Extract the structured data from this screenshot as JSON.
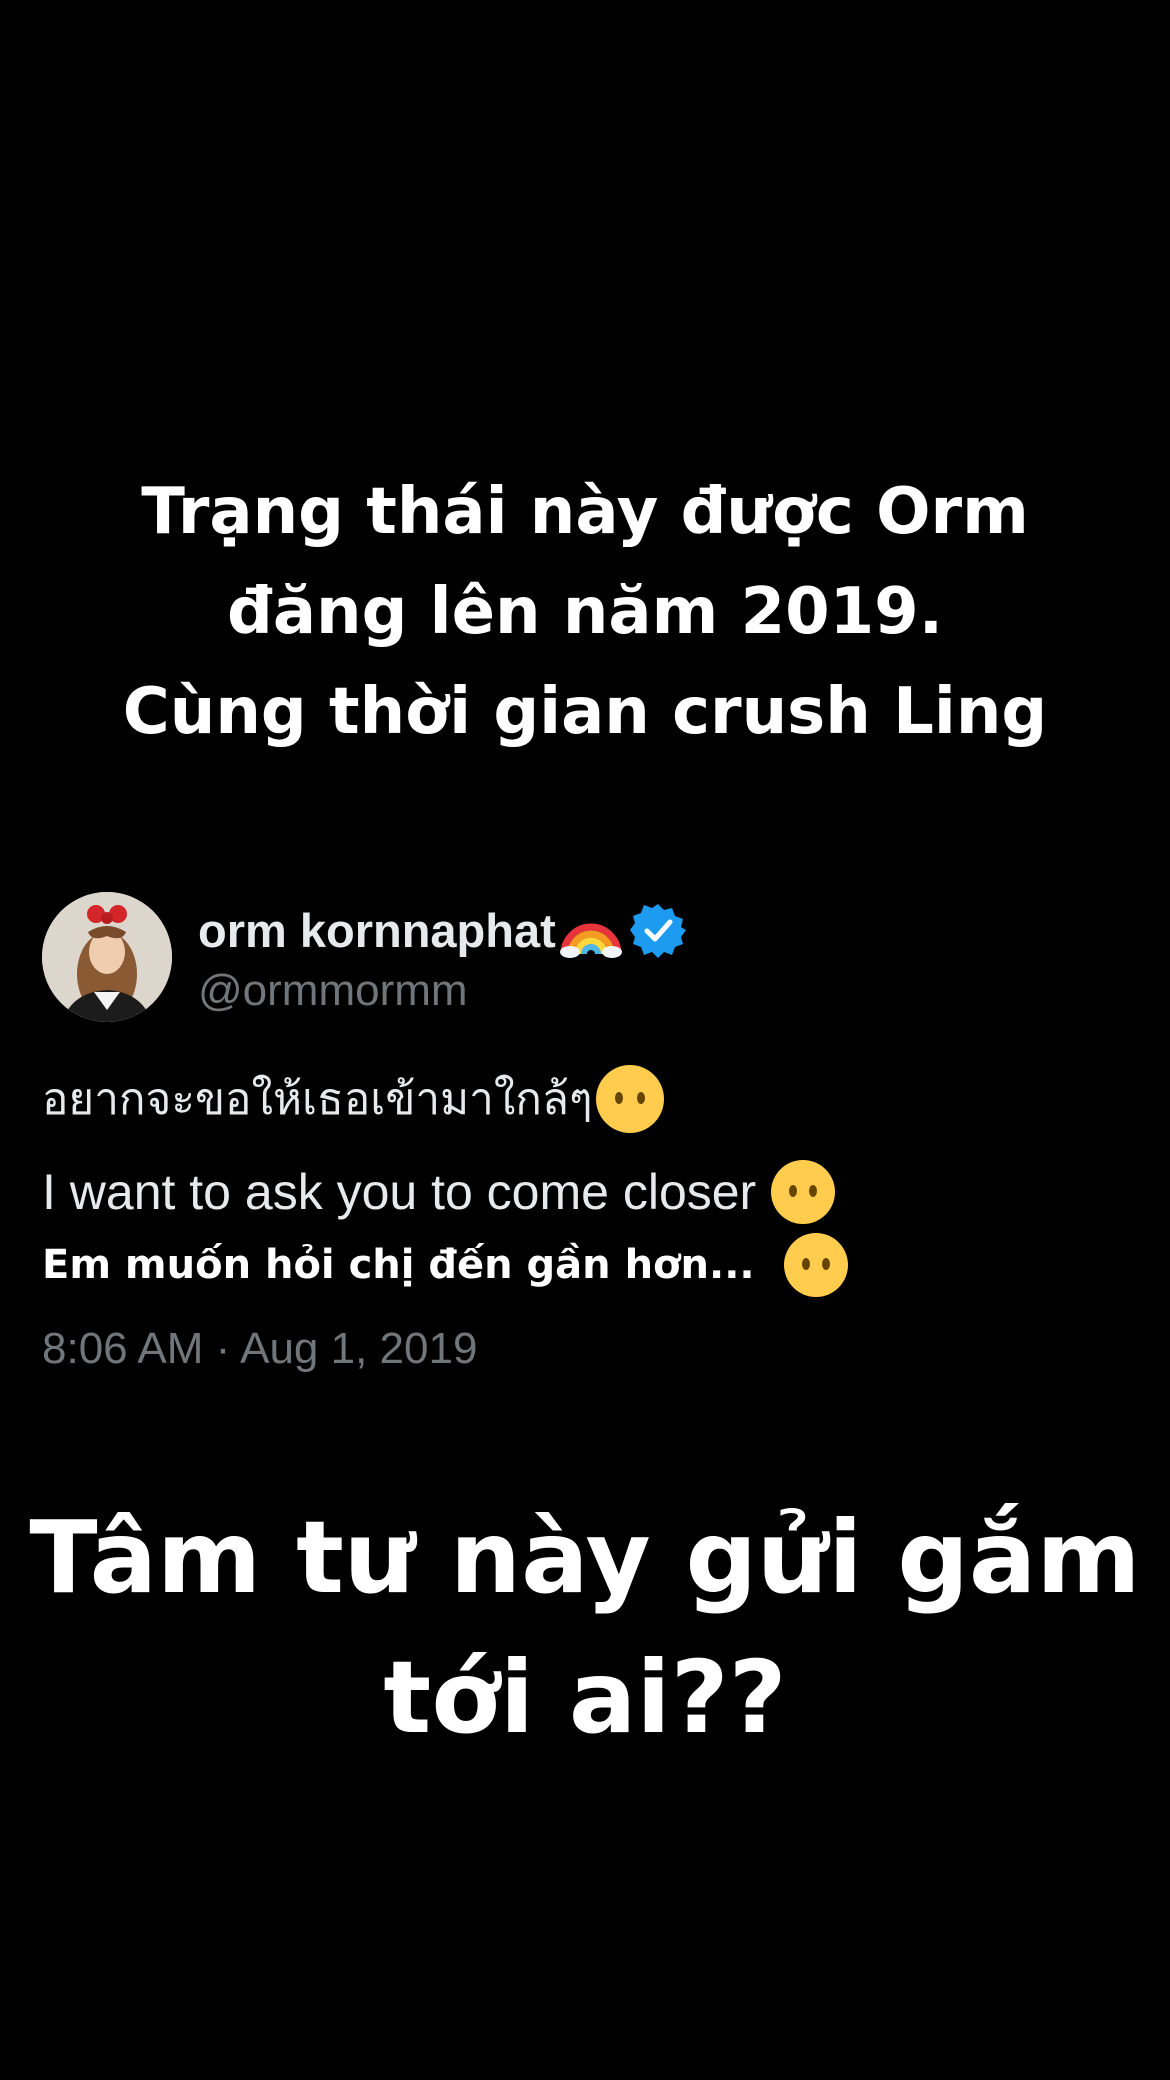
{
  "top_caption": {
    "lines": [
      "Trạng thái này được Orm",
      "đăng lên năm 2019.",
      "Cùng thời gian crush Ling"
    ]
  },
  "tweet": {
    "display_name": "orm kornnaphat",
    "name_emoji": "rainbow-icon",
    "verified_badge": "verified-icon",
    "handle": "@ormmormm",
    "text_thai": "อยากจะขอให้เธอเข้ามาใกล้ๆ",
    "text_english": "I want to ask you to come closer",
    "text_vietnamese": "Em muốn hỏi chị đến gần hơn...",
    "line_emoji": "neutral-face-emoji",
    "timestamp": "8:06 AM · Aug 1, 2019"
  },
  "bottom_caption": {
    "lines": [
      "Tâm tư này gửi gắm",
      "tới ai??"
    ]
  },
  "colors": {
    "background": "#000000",
    "caption_text": "#ffffff",
    "tweet_primary_text": "#e7e9ea",
    "tweet_secondary_text": "#71767b",
    "verified_blue": "#1d9bf0",
    "emoji_yellow": "#ffcc4d"
  }
}
